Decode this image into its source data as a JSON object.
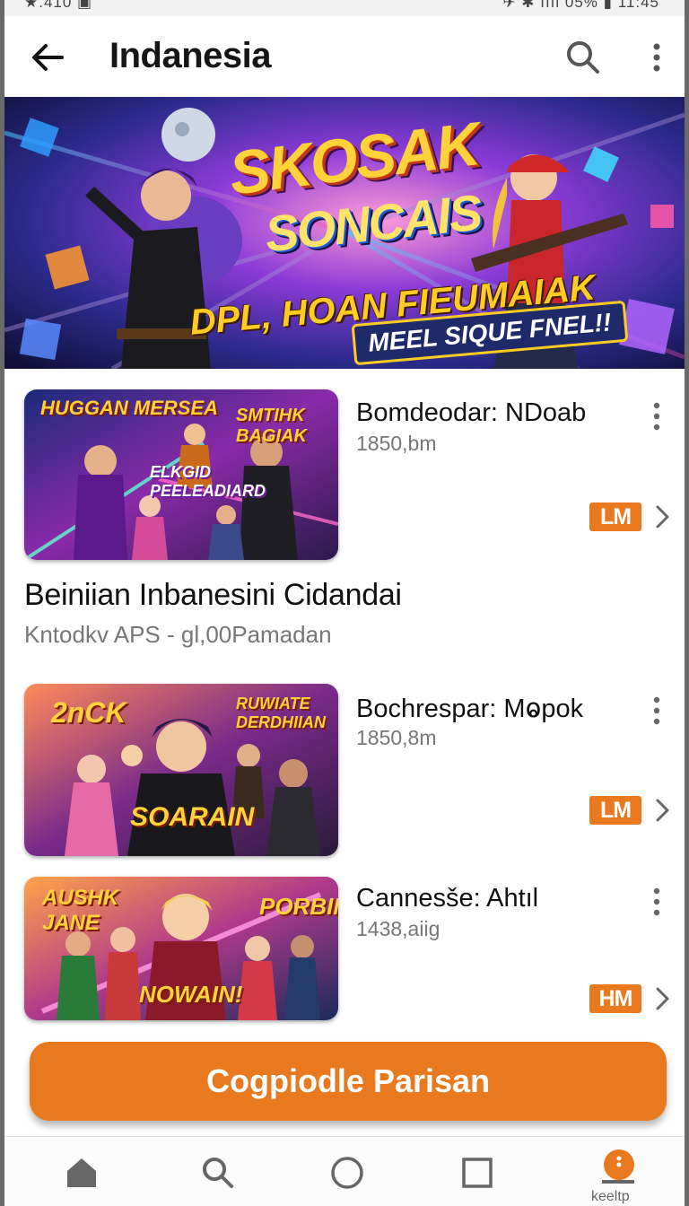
{
  "status_bar": {
    "left": "★.410 ▣",
    "right": "✈ ✱ ıııl 05% ▮ 11:45"
  },
  "app_bar": {
    "title": "Indanesia"
  },
  "hero": {
    "title": "SKOSAK",
    "subtitle": "SONCAIS",
    "tagline": "DPL, HOAN FIEUMAIAK",
    "pill": "MEEL SIQUE FNEL!!"
  },
  "items": [
    {
      "thumb_text_a": "HUGGAN MERSEA",
      "thumb_text_b": "SMTIHK BAGIAK",
      "thumb_text_c": "ELKGID PEELEADIARD",
      "title": "Bomdeodar: NDoab",
      "subtitle": "1850,bm",
      "badge": "LM"
    },
    {
      "thumb_text_a": "2nCK",
      "thumb_text_b": "RUWIATE DERDHIIAN",
      "thumb_text_c": "SOARAIN",
      "title": "Bochrespar: Mⱺpok",
      "subtitle": "1850,8m",
      "badge": "LM"
    },
    {
      "thumb_text_a": "AUSHK JANE",
      "thumb_text_b": "PORBIN",
      "thumb_text_c": "NOWAIN!",
      "title": "Cannesše: Ahtıl",
      "subtitle": "1438,aiig",
      "badge": "HM"
    }
  ],
  "section": {
    "title": "Beiniian Inbanesini Cidandai",
    "subtitle": "Kntodkv APS - gl,00Pamadan"
  },
  "cta": {
    "label": "Cogpiodle Parisan"
  },
  "bottom_nav": {
    "profile_label": "keeltp"
  },
  "colors": {
    "accent": "#e8791f",
    "text": "#111111",
    "muted": "#777777"
  },
  "icons": [
    "back-arrow-icon",
    "search-icon",
    "more-vert-icon",
    "chevron-right-icon",
    "home-icon",
    "circle-icon",
    "square-icon",
    "profile-icon"
  ]
}
